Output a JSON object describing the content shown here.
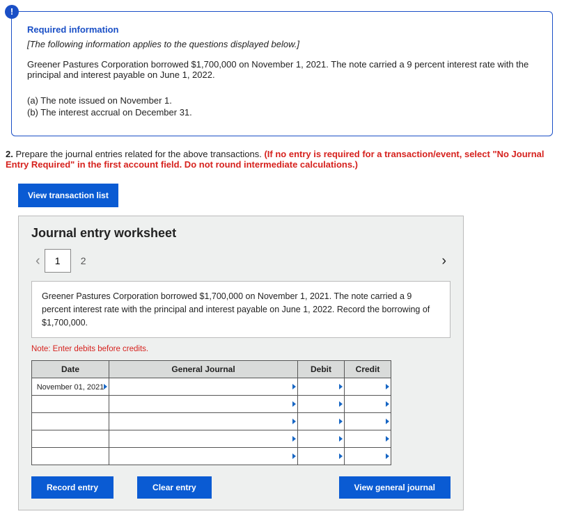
{
  "info": {
    "bang": "!",
    "title": "Required information",
    "subtitle": "[The following information applies to the questions displayed below.]",
    "body": "Greener Pastures Corporation borrowed $1,700,000 on November 1, 2021. The note carried a 9 percent interest rate with the principal and interest payable on June 1, 2022.",
    "item_a": "(a) The note issued on November 1.",
    "item_b": "(b) The interest accrual on December 31."
  },
  "question": {
    "number": "2.",
    "text": "Prepare the journal entries related for the above transactions. ",
    "red": "(If no entry is required for a transaction/event, select \"No Journal Entry Required\" in the first account field. Do not round intermediate calculations.)"
  },
  "buttons": {
    "view_list": "View transaction list",
    "record": "Record entry",
    "clear": "Clear entry",
    "view_general": "View general journal"
  },
  "worksheet": {
    "title": "Journal entry worksheet",
    "tabs": [
      "1",
      "2"
    ],
    "active_tab": 0,
    "prev": "‹",
    "next": "›",
    "description": "Greener Pastures Corporation borrowed $1,700,000 on November 1, 2021. The note carried a 9 percent interest rate with the principal and interest payable on June 1, 2022. Record the borrowing of $1,700,000.",
    "note": "Note: Enter debits before credits.",
    "headers": {
      "date": "Date",
      "gj": "General Journal",
      "debit": "Debit",
      "credit": "Credit"
    },
    "rows": [
      {
        "date": "November 01, 2021",
        "gj": "",
        "debit": "",
        "credit": ""
      },
      {
        "date": "",
        "gj": "",
        "debit": "",
        "credit": ""
      },
      {
        "date": "",
        "gj": "",
        "debit": "",
        "credit": ""
      },
      {
        "date": "",
        "gj": "",
        "debit": "",
        "credit": ""
      },
      {
        "date": "",
        "gj": "",
        "debit": "",
        "credit": ""
      }
    ]
  }
}
